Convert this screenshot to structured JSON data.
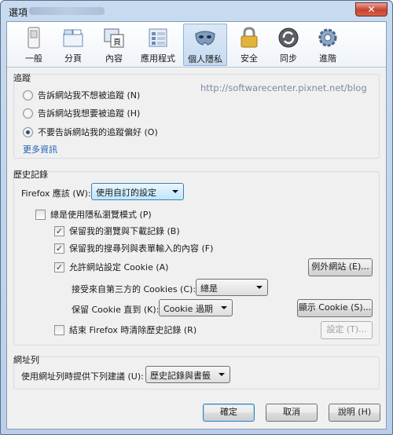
{
  "window": {
    "title": "選項",
    "close_glyph": "✕"
  },
  "toolbar": {
    "tabs": [
      {
        "label": "一般",
        "icon": "switch-icon"
      },
      {
        "label": "分頁",
        "icon": "tabs-icon"
      },
      {
        "label": "內容",
        "icon": "content-icon"
      },
      {
        "label": "應用程式",
        "icon": "applications-icon"
      },
      {
        "label": "個人隱私",
        "icon": "privacy-mask-icon",
        "active": true
      },
      {
        "label": "安全",
        "icon": "lock-icon"
      },
      {
        "label": "同步",
        "icon": "sync-icon"
      },
      {
        "label": "進階",
        "icon": "gear-icon"
      }
    ]
  },
  "watermark": "http://softwarecenter.pixnet.net/blog",
  "tracking": {
    "title": "追蹤",
    "options": [
      {
        "label": "告訴網站我不想被追蹤 (N)",
        "selected": false
      },
      {
        "label": "告訴網站我想要被追蹤 (H)",
        "selected": false
      },
      {
        "label": "不要告訴網站我的追蹤偏好 (O)",
        "selected": true
      }
    ],
    "more_info": "更多資訊"
  },
  "history": {
    "title": "歷史記錄",
    "firefox_will_label": "Firefox 應該 (W):",
    "firefox_will_value": "使用自訂的設定",
    "always_private_label": "總是使用隱私瀏覽模式 (P)",
    "always_private_checked": false,
    "remember_browsing_label": "保留我的瀏覽與下載記錄 (B)",
    "remember_browsing_checked": true,
    "remember_search_label": "保留我的搜尋列與表單輸入的內容 (F)",
    "remember_search_checked": true,
    "accept_cookies_label": "允許網站設定 Cookie (A)",
    "accept_cookies_checked": true,
    "exceptions_button": "例外網站 (E)...",
    "third_party_label": "接受來自第三方的 Cookies (C):",
    "third_party_value": "總是",
    "keep_until_label": "保留 Cookie 直到 (K):",
    "keep_until_value": "Cookie 過期",
    "show_cookies_button": "顯示 Cookie (S)...",
    "clear_on_close_label": "結束 Firefox 時清除歷史記錄 (R)",
    "clear_on_close_checked": false,
    "settings_button": "設定 (T)..."
  },
  "location_bar": {
    "title": "網址列",
    "suggest_label": "使用網址列時提供下列建議 (U):",
    "suggest_value": "歷史記錄與書籤"
  },
  "buttons": {
    "ok": "確定",
    "cancel": "取消",
    "help": "說明 (H)"
  },
  "check_glyph": "✓"
}
